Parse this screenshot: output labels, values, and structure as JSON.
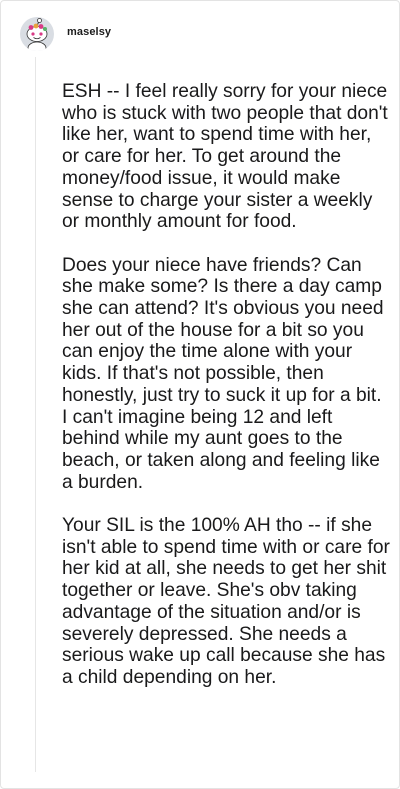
{
  "comment": {
    "username": "maselsy",
    "avatar_icon": "reddit-snoo-avatar-icon",
    "paragraphs": [
      "ESH -- I feel really sorry for your niece who is stuck with two people that don't like her, want to spend time with her, or care for her. To get around the money/food issue, it would make sense to charge your sister a weekly or monthly amount for food.",
      "Does your niece have friends? Can she make some? Is there a day camp she can attend? It's obvious you need her out of the house for a bit so you can enjoy the time alone with your kids. If that's not possible, then honestly, just try to suck it up for a bit. I can't imagine being 12 and left behind while my aunt goes to the beach, or taken along and feeling like a burden.",
      "Your SIL is the 100% AH tho -- if she isn't able to spend time with or care for her kid at all, she needs to get her shit together or leave. She's obv taking advantage of the situation and/or is severely depressed. She needs a serious wake up call because she has a child depending on her."
    ]
  },
  "colors": {
    "background": "#ffffff",
    "text": "#1a1a1b",
    "username": "#1c1c1c",
    "thread_line": "#e6e6e6",
    "avatar_bg": "#d9dde3",
    "avatar_accent": "#d93a86"
  }
}
